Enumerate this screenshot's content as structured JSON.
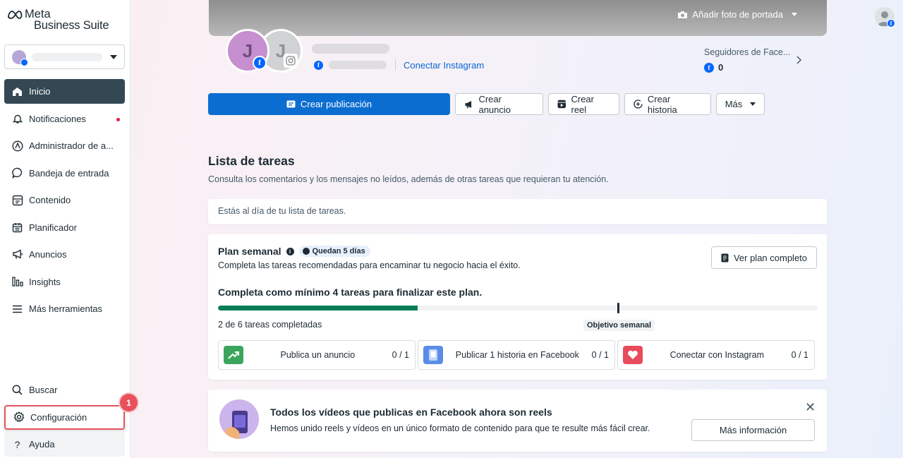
{
  "brand": {
    "line1": "Meta",
    "line2": "Business Suite",
    "accent": "#0866ff"
  },
  "sidebar": {
    "items": [
      {
        "label": "Inicio",
        "icon": "home-icon",
        "active": true
      },
      {
        "label": "Notificaciones",
        "icon": "bell-icon",
        "dot": true
      },
      {
        "label": "Administrador de a...",
        "icon": "ads-manager-icon"
      },
      {
        "label": "Bandeja de entrada",
        "icon": "chat-bubble-icon"
      },
      {
        "label": "Contenido",
        "icon": "content-icon"
      },
      {
        "label": "Planificador",
        "icon": "calendar-icon"
      },
      {
        "label": "Anuncios",
        "icon": "megaphone-icon"
      },
      {
        "label": "Insights",
        "icon": "bar-chart-icon"
      },
      {
        "label": "Más herramientas",
        "icon": "menu-icon"
      }
    ],
    "bottom": [
      {
        "label": "Buscar",
        "icon": "search-icon"
      },
      {
        "label": "Configuración",
        "icon": "gear-icon"
      },
      {
        "label": "Ayuda",
        "icon": "question-icon"
      }
    ],
    "badge": "1"
  },
  "profile": {
    "cover_button": "Añadir foto de portada",
    "avatar_letter": "J",
    "connect_instagram": "Conectar Instagram",
    "followers_label": "Seguidores de Face...",
    "followers_count": "0"
  },
  "actions": {
    "create_post": "Crear publicación",
    "create_ad": "Crear anuncio",
    "create_reel": "Crear reel",
    "create_story": "Crear historia",
    "more": "Más"
  },
  "tasks": {
    "title": "Lista de tareas",
    "subtitle": "Consulta los comentarios y los mensajes no leídos, además de otras tareas que requieran tu atención.",
    "status": "Estás al día de tu lista de tareas."
  },
  "plan": {
    "title": "Plan semanal",
    "days_left": "Quedan 5 días",
    "subtitle": "Completa las tareas recomendadas para encaminar tu negocio hacia el éxito.",
    "view_button": "Ver plan completo",
    "goal": "Completa como mínimo 4 tareas para finalizar este plan.",
    "progress_text": "2 de 6 tareas completadas",
    "progress_fraction": 0.333,
    "target_fraction": 0.667,
    "target_label": "Objetivo semanal",
    "progress_color": "#0a7d55",
    "items": [
      {
        "label": "Publica un anuncio",
        "count": "0 / 1",
        "icon": "trend-up-icon"
      },
      {
        "label": "Publicar 1 historia en Facebook",
        "count": "0 / 1",
        "icon": "story-icon"
      },
      {
        "label": "Conectar con Instagram",
        "count": "0 / 1",
        "icon": "heart-icon"
      }
    ]
  },
  "reels": {
    "title": "Todos los vídeos que publicas en Facebook ahora son reels",
    "subtitle": "Hemos unido reels y vídeos en un único formato de contenido para que te resulte más fácil crear.",
    "button": "Más información"
  }
}
